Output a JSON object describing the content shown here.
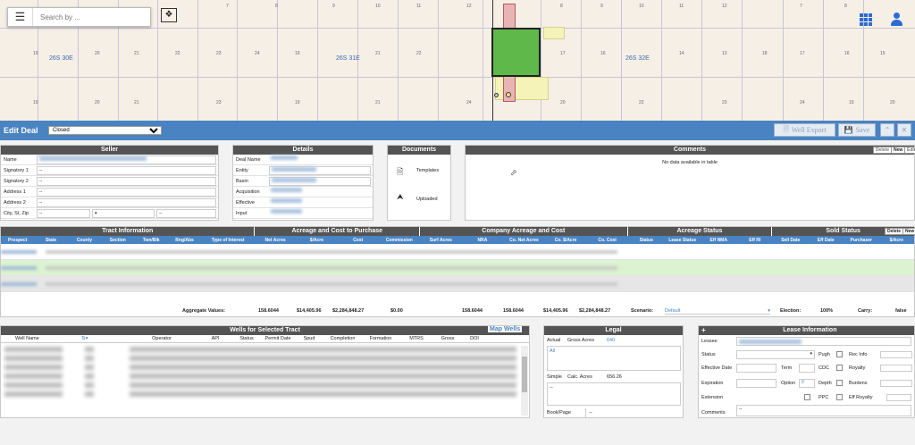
{
  "map": {
    "search_placeholder": "Search by ...",
    "township_labels": [
      "26S 30E",
      "26S 31E",
      "26S 32E"
    ],
    "section_numbers": [
      "7",
      "8",
      "9",
      "10",
      "11",
      "12",
      "7",
      "8",
      "9",
      "10",
      "11",
      "12",
      "7",
      "8",
      "9",
      "10",
      "11",
      "12",
      "19",
      "20",
      "21",
      "22",
      "23",
      "24",
      "19",
      "20",
      "21",
      "22",
      "23",
      "24",
      "17",
      "16",
      "15",
      "14",
      "13",
      "18",
      "17",
      "16",
      "15",
      "14",
      "13"
    ]
  },
  "deal": {
    "title": "Edit Deal",
    "status": "Closed",
    "well_export": "Well Export",
    "save": "Save"
  },
  "seller": {
    "title": "Seller",
    "fields": [
      "Name",
      "Signatory 1",
      "Signatory 2",
      "Address 1",
      "Address 2",
      "City, St, Zip"
    ],
    "placeholder": "--"
  },
  "details": {
    "title": "Details",
    "fields": [
      "Deal Name",
      "Entity",
      "Basin",
      "Acquisition",
      "Effective",
      "Input"
    ]
  },
  "documents": {
    "title": "Documents",
    "items": [
      "Templates",
      "Uploaded"
    ]
  },
  "comments": {
    "title": "Comments",
    "empty": "No data available in table",
    "buttons": [
      "Delete",
      "New",
      "Edit"
    ]
  },
  "groups": [
    {
      "label": "Tract Information"
    },
    {
      "label": "Acreage and Cost to Purchase"
    },
    {
      "label": "Company Acreage and Cost"
    },
    {
      "label": "Acreage Status"
    },
    {
      "label": "Sold Status"
    }
  ],
  "tract_cols": [
    "Prospect",
    "State",
    "County",
    "Section",
    "Twn/Blk",
    "Rng/Abs",
    "Type of Interest"
  ],
  "purchase_cols": [
    "Net Acres",
    "$/Acre",
    "Cost",
    "Commission"
  ],
  "company_cols": [
    "Surf Acres",
    "NRA",
    "Co. Net Acres",
    "Co. $/Acre",
    "Co. Cost"
  ],
  "status_cols": [
    "Status",
    "Lease Status",
    "Eff NMA",
    "Eff RI"
  ],
  "sold_cols": [
    "Sell Date",
    "Eff Date",
    "Purchaser",
    "$/Acre"
  ],
  "sold_buttons": [
    "Delete",
    "New"
  ],
  "aggregate": {
    "label": "Aggregate Values:",
    "net_acres": "158.6044",
    "per_acre": "$14,405.96",
    "cost": "$2,284,848.27",
    "commission": "$0.00",
    "nra": "158.6044",
    "co_net": "158.6044",
    "co_per_acre": "$14,405.96",
    "co_cost": "$2,284,848.27",
    "scenario_label": "Scenario:",
    "scenario": "Default",
    "election_label": "Election:",
    "election": "100%",
    "carry_label": "Carry:",
    "carry": "false"
  },
  "wells": {
    "title": "Wells for Selected Tract",
    "map_button": "Map Wells",
    "cols": [
      "Well Name",
      "Operator",
      "API",
      "Status",
      "Permit Date",
      "Spud",
      "Completion",
      "Formation",
      "MTRS",
      "Gross",
      "DOI"
    ]
  },
  "legal": {
    "title": "Legal",
    "actual_label": "Actual",
    "gross_label": "Gross Acres",
    "gross": "640",
    "all": "All",
    "simple_label": "Simple",
    "calc_label": "Calc. Acres",
    "calc": "656.26",
    "book_label": "Book/Page",
    "book": "--",
    "dash": "--"
  },
  "lease": {
    "title": "Lease Information",
    "plus": "+",
    "left": [
      "Lessee",
      "Status",
      "Effective Date",
      "Expiration",
      "Extension",
      "Comments"
    ],
    "term": "Term",
    "option": "Option",
    "option_val": "0",
    "checks": [
      "Pugh",
      "CDC",
      "Depth",
      "PPC"
    ],
    "right": [
      "Rec Info",
      "Royalty",
      "Burdens",
      "Eff Royalty"
    ],
    "comments_val": "--"
  }
}
